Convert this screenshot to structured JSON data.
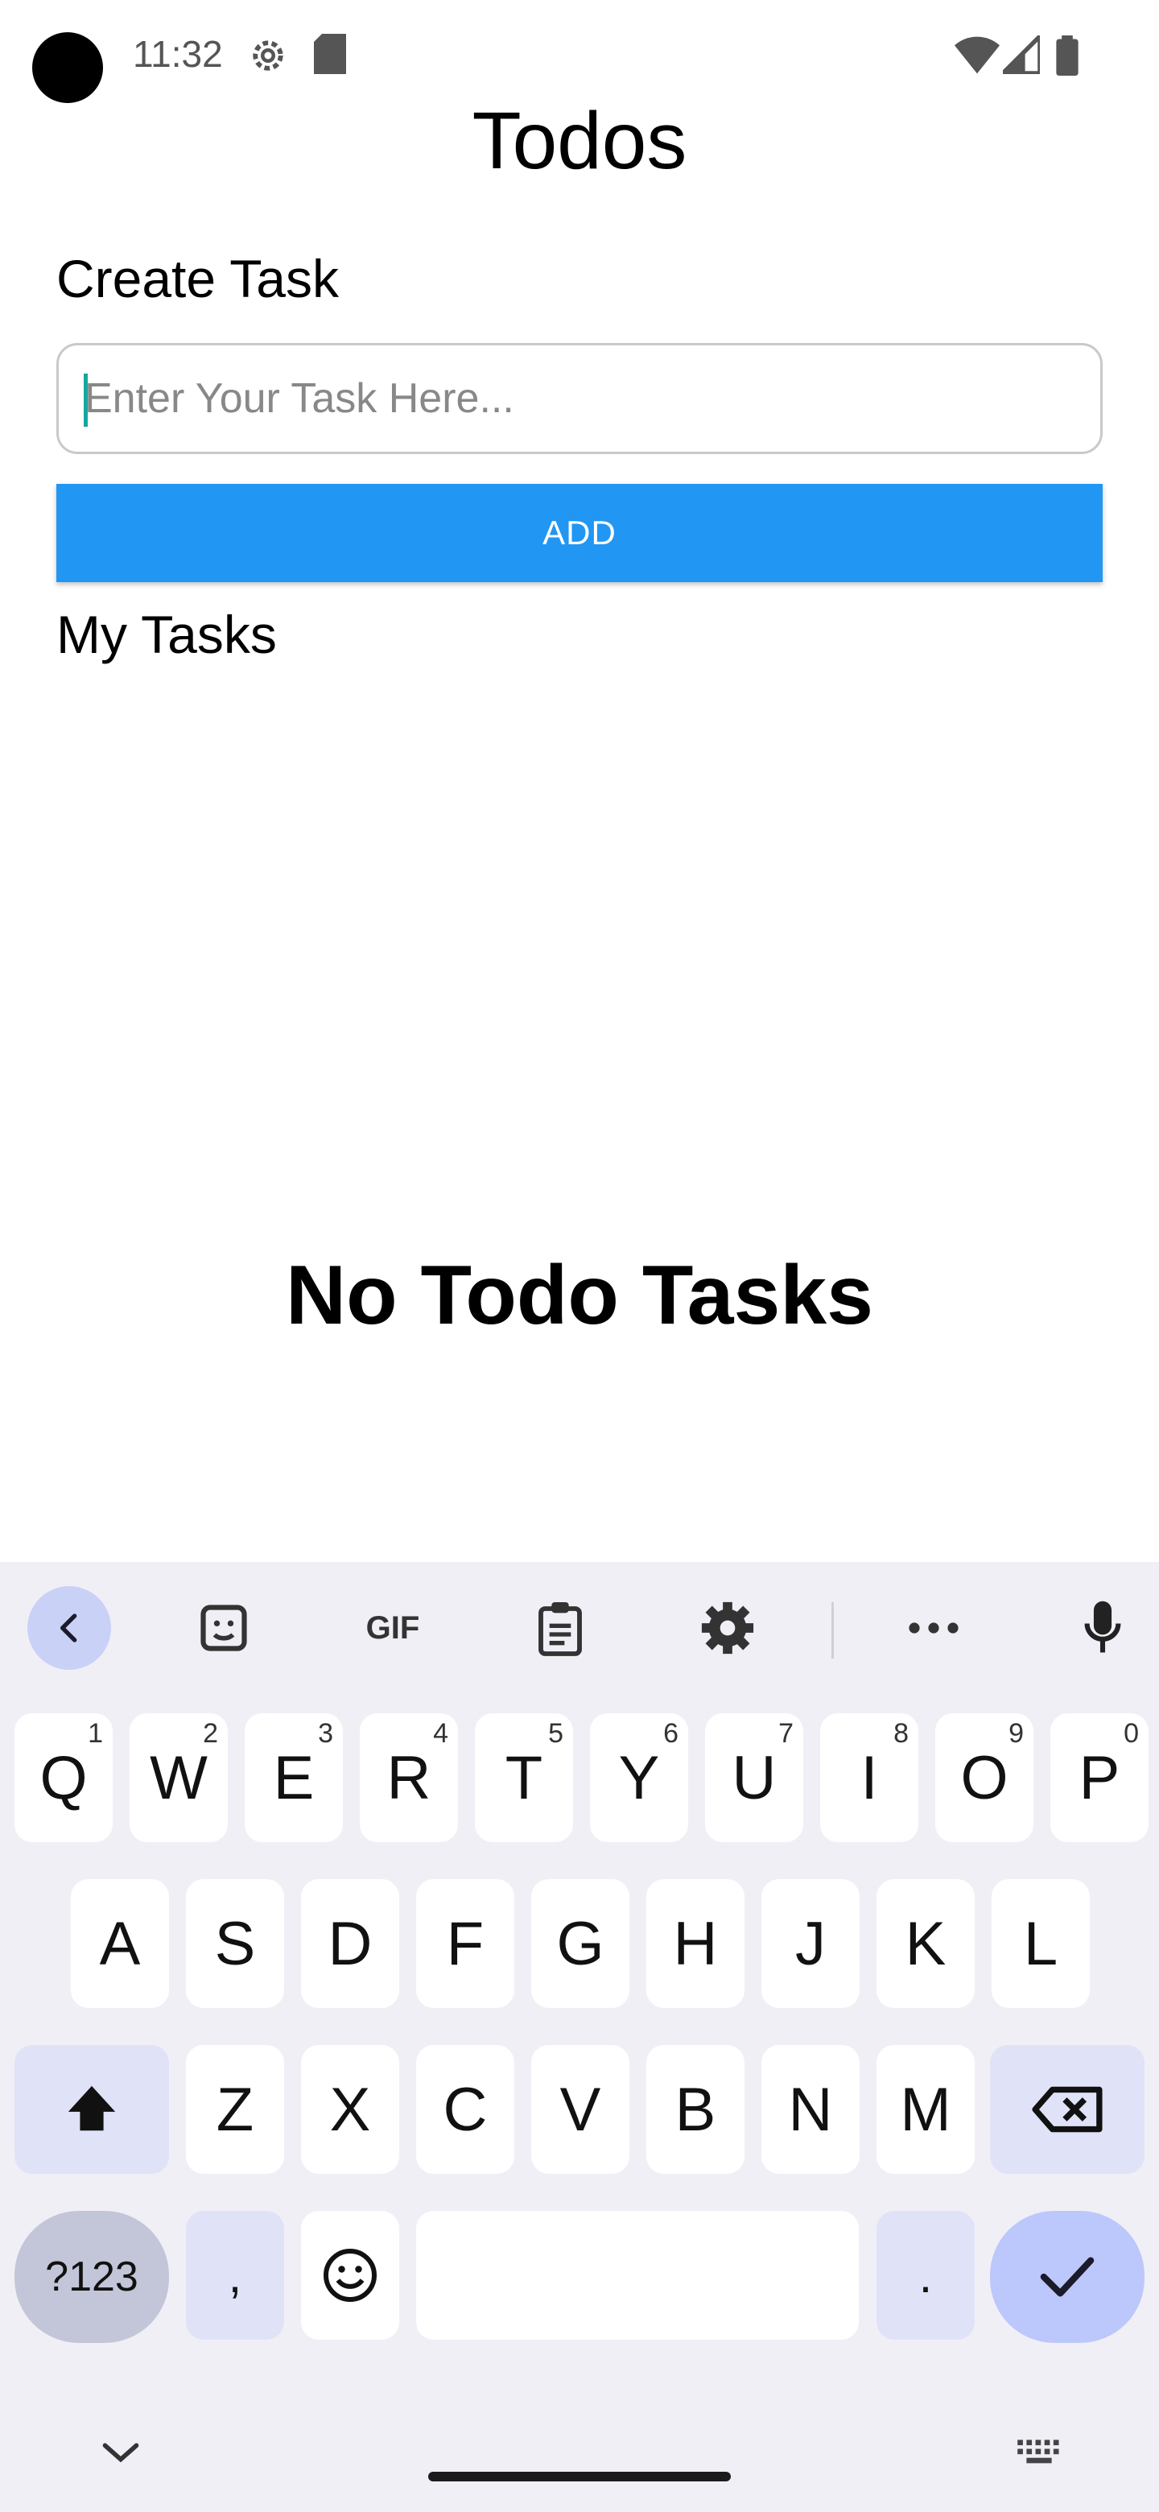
{
  "status_bar": {
    "time": "11:32",
    "icons": [
      "settings-gear-icon",
      "sd-card-icon",
      "wifi-icon",
      "cell-signal-icon",
      "battery-icon"
    ]
  },
  "app": {
    "title": "Todos",
    "create_label": "Create Task",
    "input_placeholder": "Enter Your Task Here...",
    "input_value": "",
    "add_button": "ADD",
    "tasks_label": "My Tasks",
    "empty_message": "No Todo Tasks",
    "accent_color": "#2196f3"
  },
  "keyboard": {
    "toolbar": [
      "back-icon",
      "sticker-icon",
      "GIF",
      "clipboard-icon",
      "settings-icon",
      "more-icon",
      "mic-icon"
    ],
    "gif_label": "GIF",
    "row1": [
      {
        "key": "Q",
        "hint": "1"
      },
      {
        "key": "W",
        "hint": "2"
      },
      {
        "key": "E",
        "hint": "3"
      },
      {
        "key": "R",
        "hint": "4"
      },
      {
        "key": "T",
        "hint": "5"
      },
      {
        "key": "Y",
        "hint": "6"
      },
      {
        "key": "U",
        "hint": "7"
      },
      {
        "key": "I",
        "hint": "8"
      },
      {
        "key": "O",
        "hint": "9"
      },
      {
        "key": "P",
        "hint": "0"
      }
    ],
    "row2": [
      "A",
      "S",
      "D",
      "F",
      "G",
      "H",
      "J",
      "K",
      "L"
    ],
    "row3": [
      "Z",
      "X",
      "C",
      "V",
      "B",
      "N",
      "M"
    ],
    "sym_label": "?123",
    "comma": ",",
    "period": "."
  }
}
